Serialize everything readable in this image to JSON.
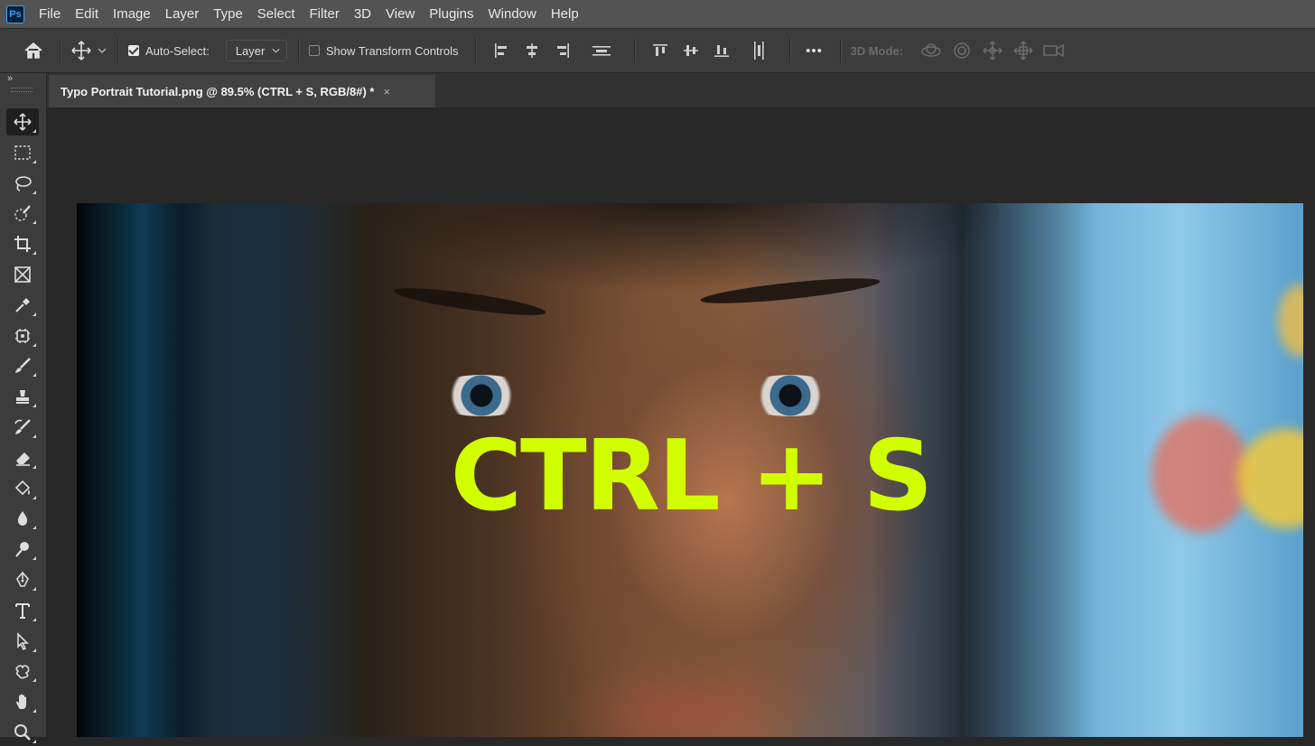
{
  "app": {
    "logo_text": "Ps",
    "accent": "#31a8ff",
    "text_color": "#d2ff00"
  },
  "menu": [
    "File",
    "Edit",
    "Image",
    "Layer",
    "Type",
    "Select",
    "Filter",
    "3D",
    "View",
    "Plugins",
    "Window",
    "Help"
  ],
  "options": {
    "auto_select_label": "Auto-Select:",
    "auto_select_checked": true,
    "layer_select_value": "Layer",
    "show_transform_label": "Show Transform Controls",
    "show_transform_checked": false,
    "more_label": "•••",
    "mode_3d_label": "3D Mode:"
  },
  "toolbar": {
    "collapse_glyph": "»",
    "tools": [
      "move-tool",
      "rectangular-marquee-tool",
      "lasso-tool",
      "quick-selection-tool",
      "crop-tool",
      "frame-tool",
      "eyedropper-tool",
      "spot-healing-tool",
      "brush-tool",
      "clone-stamp-tool",
      "history-brush-tool",
      "eraser-tool",
      "paint-bucket-tool",
      "blur-tool",
      "dodge-tool",
      "pen-tool",
      "type-tool",
      "path-selection-tool",
      "custom-shape-tool",
      "hand-tool",
      "zoom-tool"
    ],
    "active_tool": "move-tool"
  },
  "document": {
    "tab_title": "Typo Portrait Tutorial.png @ 89.5% (CTRL + S, RGB/8#) *",
    "close_glyph": "×"
  },
  "canvas": {
    "headline": "CTRL + S"
  }
}
